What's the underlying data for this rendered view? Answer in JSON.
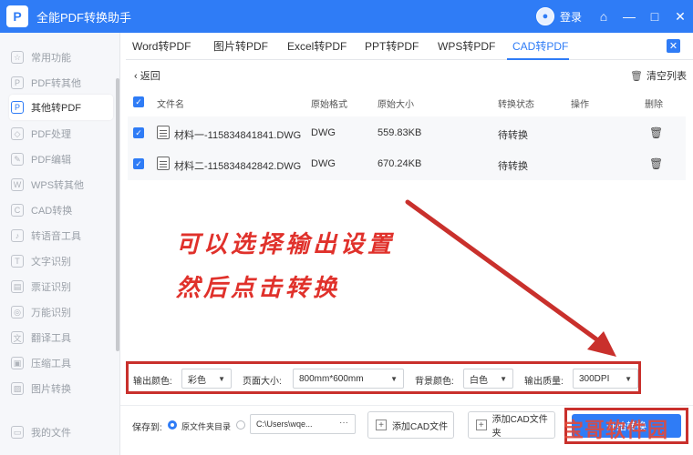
{
  "window": {
    "title": "全能PDF转换助手",
    "logo_letter": "P",
    "login_label": "登录",
    "controls": [
      "shirt-icon",
      "minimize-icon",
      "maximize-icon",
      "close-icon"
    ]
  },
  "sidebar": {
    "items": [
      {
        "label": "常用功能"
      },
      {
        "label": "PDF转其他"
      },
      {
        "label": "其他转PDF"
      },
      {
        "label": "PDF处理"
      },
      {
        "label": "PDF编辑"
      },
      {
        "label": "WPS转其他"
      },
      {
        "label": "CAD转换"
      },
      {
        "label": "转语音工具"
      },
      {
        "label": "文字识别"
      },
      {
        "label": "票证识别"
      },
      {
        "label": "万能识别"
      },
      {
        "label": "翻译工具"
      },
      {
        "label": "压缩工具"
      },
      {
        "label": "图片转换"
      },
      {
        "label": "我的文件"
      }
    ],
    "active_index": 2
  },
  "tabs": [
    {
      "label": "Word转PDF"
    },
    {
      "label": "图片转PDF"
    },
    {
      "label": "Excel转PDF"
    },
    {
      "label": "PPT转PDF"
    },
    {
      "label": "WPS转PDF"
    },
    {
      "label": "CAD转PDF"
    }
  ],
  "active_tab": 5,
  "toolbar": {
    "back_label": "返回",
    "clear_label": "清空列表"
  },
  "table": {
    "headers": [
      "文件名",
      "原始格式",
      "原始大小",
      "转换状态",
      "操作",
      "删除"
    ],
    "rows": [
      {
        "name": "材料一-115834841841.DWG",
        "format": "DWG",
        "size": "559.83KB",
        "status": "待转换"
      },
      {
        "name": "材料二-115834842842.DWG",
        "format": "DWG",
        "size": "670.24KB",
        "status": "待转换"
      }
    ]
  },
  "annotation": {
    "line1": "可以选择输出设置",
    "line2": "然后点击转换",
    "color": "#e0312b"
  },
  "settings": {
    "output_color_label": "输出颜色:",
    "output_color_value": "彩色",
    "page_size_label": "页面大小:",
    "page_size_value": "800mm*600mm",
    "bg_color_label": "背景颜色:",
    "bg_color_value": "白色",
    "quality_label": "输出质量:",
    "quality_value": "300DPI"
  },
  "bottom": {
    "save_to_label": "保存到:",
    "option_source_dir": "原文件夹目录",
    "path_value": "C:\\Users\\wqe...",
    "path_more": "···",
    "add_file_label": "添加CAD文件",
    "add_folder_label": "添加CAD文件夹",
    "convert_label": "开始转换",
    "watermark": "宝哥软件园"
  },
  "colors": {
    "accent": "#2f7cf6",
    "highlight_border": "#c9302c"
  }
}
